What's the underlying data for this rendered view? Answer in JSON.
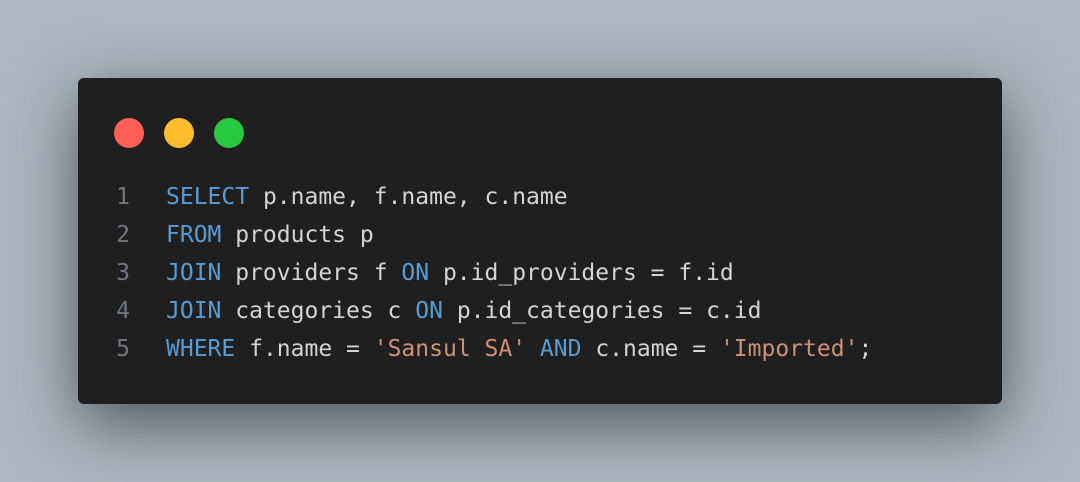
{
  "window": {
    "colors": {
      "background": "#1f1f1f",
      "close": "#ff5f56",
      "minimize": "#ffbd2e",
      "maximize": "#27c93f",
      "keyword": "#569cd6",
      "string": "#ce9178",
      "text": "#d4d4d4",
      "line_number": "#6e7681"
    },
    "buttons": {
      "close": "close",
      "minimize": "minimize",
      "maximize": "maximize"
    }
  },
  "code": {
    "language": "sql",
    "lines": [
      {
        "number": "1",
        "tokens": [
          {
            "type": "kw",
            "text": "SELECT"
          },
          {
            "type": "txt",
            "text": " p.name, f.name, c.name"
          }
        ]
      },
      {
        "number": "2",
        "tokens": [
          {
            "type": "kw",
            "text": "FROM"
          },
          {
            "type": "txt",
            "text": " products p"
          }
        ]
      },
      {
        "number": "3",
        "tokens": [
          {
            "type": "kw",
            "text": "JOIN"
          },
          {
            "type": "txt",
            "text": " providers f "
          },
          {
            "type": "kw",
            "text": "ON"
          },
          {
            "type": "txt",
            "text": " p.id_providers = f.id"
          }
        ]
      },
      {
        "number": "4",
        "tokens": [
          {
            "type": "kw",
            "text": "JOIN"
          },
          {
            "type": "txt",
            "text": " categories c "
          },
          {
            "type": "kw",
            "text": "ON"
          },
          {
            "type": "txt",
            "text": " p.id_categories = c.id"
          }
        ]
      },
      {
        "number": "5",
        "tokens": [
          {
            "type": "kw",
            "text": "WHERE"
          },
          {
            "type": "txt",
            "text": " f.name = "
          },
          {
            "type": "str",
            "text": "'Sansul SA'"
          },
          {
            "type": "txt",
            "text": " "
          },
          {
            "type": "kw",
            "text": "AND"
          },
          {
            "type": "txt",
            "text": " c.name = "
          },
          {
            "type": "str",
            "text": "'Imported'"
          },
          {
            "type": "txt",
            "text": ";"
          }
        ]
      }
    ]
  }
}
